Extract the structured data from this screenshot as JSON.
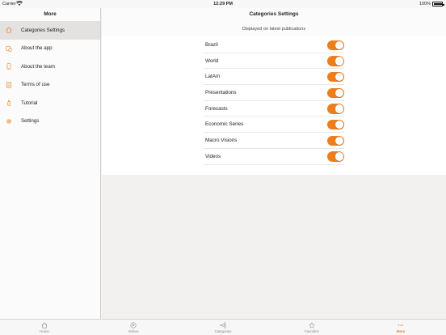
{
  "status_bar": {
    "carrier": "Carrier",
    "time": "12:29 PM",
    "battery": "100%",
    "battery_level": 1.0
  },
  "sidebar": {
    "title": "More",
    "items": [
      {
        "label": "Categories Settings",
        "icon": "home-icon",
        "selected": true
      },
      {
        "label": "About the app",
        "icon": "app-info-icon"
      },
      {
        "label": "About the team",
        "icon": "phone-icon"
      },
      {
        "label": "Terms of use",
        "icon": "document-icon"
      },
      {
        "label": "Tutorial",
        "icon": "tutorial-icon"
      },
      {
        "label": "Settings",
        "icon": "gear-icon"
      }
    ]
  },
  "main": {
    "title": "Categories Settings",
    "subtitle": "Displayed on latest publications",
    "categories": [
      {
        "label": "Brazil",
        "enabled": true
      },
      {
        "label": "World",
        "enabled": true
      },
      {
        "label": "LatAm",
        "enabled": true
      },
      {
        "label": "Presentations",
        "enabled": true
      },
      {
        "label": "Forecasts",
        "enabled": true
      },
      {
        "label": "Economic Series",
        "enabled": true
      },
      {
        "label": "Macro Visions",
        "enabled": true
      },
      {
        "label": "Videos",
        "enabled": true
      }
    ]
  },
  "tabbar": {
    "tabs": [
      {
        "label": "Home",
        "icon": "home-icon"
      },
      {
        "label": "Videos",
        "icon": "play-icon"
      },
      {
        "label": "Categories",
        "icon": "categories-icon"
      },
      {
        "label": "Favorites",
        "icon": "star-icon"
      },
      {
        "label": "More",
        "icon": "more-icon",
        "active": true
      }
    ]
  },
  "colors": {
    "accent": "#ef7d1a",
    "selected_row": "#e3e2e0",
    "background": "#f2f1ef"
  }
}
